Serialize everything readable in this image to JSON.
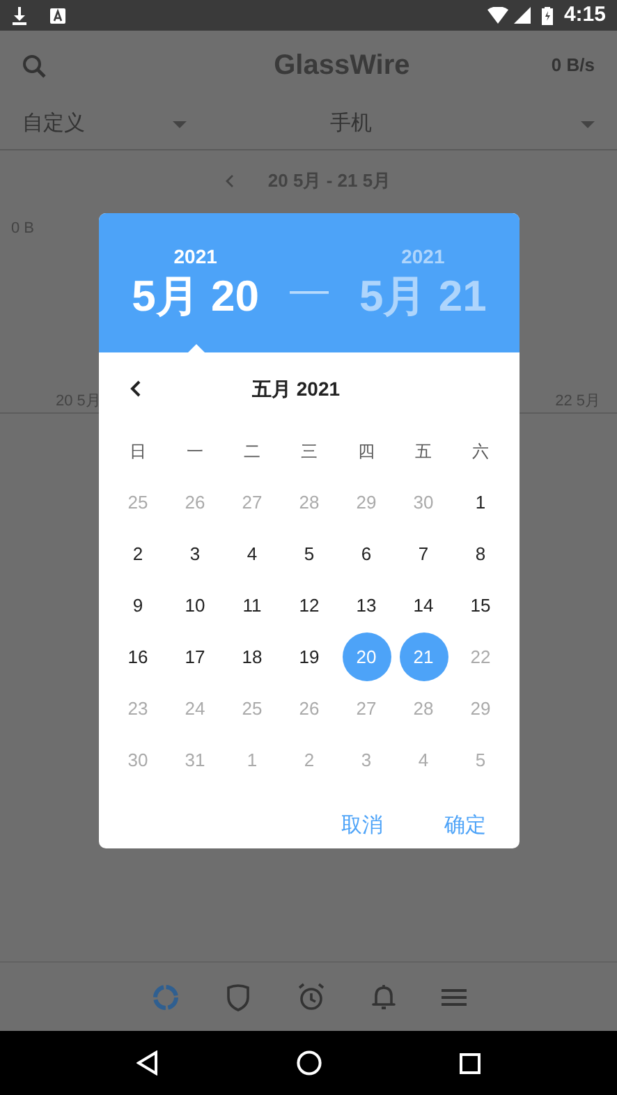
{
  "status_bar": {
    "time": "4:15"
  },
  "app_bar": {
    "title": "GlassWire",
    "speed": "0 B/s"
  },
  "filters": [
    {
      "label": "自定义"
    },
    {
      "label": "手机"
    }
  ],
  "date_nav": {
    "range": "20 5月 - 21 5月"
  },
  "graph": {
    "y_label": "0 B",
    "x_labels": [
      "20 5月",
      "22 5月"
    ]
  },
  "dialog": {
    "start": {
      "year": "2021",
      "date": "5月 20",
      "selected": true
    },
    "separator": "—",
    "end": {
      "year": "2021",
      "date": "5月 21",
      "selected": false
    },
    "month_title": "五月 2021",
    "weekdays": [
      "日",
      "一",
      "二",
      "三",
      "四",
      "五",
      "六"
    ],
    "weeks": [
      [
        {
          "day": "25",
          "disabled": true,
          "selected": false
        },
        {
          "day": "26",
          "disabled": true,
          "selected": false
        },
        {
          "day": "27",
          "disabled": true,
          "selected": false
        },
        {
          "day": "28",
          "disabled": true,
          "selected": false
        },
        {
          "day": "29",
          "disabled": true,
          "selected": false
        },
        {
          "day": "30",
          "disabled": true,
          "selected": false
        },
        {
          "day": "1",
          "disabled": false,
          "selected": false
        }
      ],
      [
        {
          "day": "2",
          "disabled": false,
          "selected": false
        },
        {
          "day": "3",
          "disabled": false,
          "selected": false
        },
        {
          "day": "4",
          "disabled": false,
          "selected": false
        },
        {
          "day": "5",
          "disabled": false,
          "selected": false
        },
        {
          "day": "6",
          "disabled": false,
          "selected": false
        },
        {
          "day": "7",
          "disabled": false,
          "selected": false
        },
        {
          "day": "8",
          "disabled": false,
          "selected": false
        }
      ],
      [
        {
          "day": "9",
          "disabled": false,
          "selected": false
        },
        {
          "day": "10",
          "disabled": false,
          "selected": false
        },
        {
          "day": "11",
          "disabled": false,
          "selected": false
        },
        {
          "day": "12",
          "disabled": false,
          "selected": false
        },
        {
          "day": "13",
          "disabled": false,
          "selected": false
        },
        {
          "day": "14",
          "disabled": false,
          "selected": false
        },
        {
          "day": "15",
          "disabled": false,
          "selected": false
        }
      ],
      [
        {
          "day": "16",
          "disabled": false,
          "selected": false
        },
        {
          "day": "17",
          "disabled": false,
          "selected": false
        },
        {
          "day": "18",
          "disabled": false,
          "selected": false
        },
        {
          "day": "19",
          "disabled": false,
          "selected": false
        },
        {
          "day": "20",
          "disabled": false,
          "selected": true
        },
        {
          "day": "21",
          "disabled": false,
          "selected": true
        },
        {
          "day": "22",
          "disabled": true,
          "selected": false
        }
      ],
      [
        {
          "day": "23",
          "disabled": true,
          "selected": false
        },
        {
          "day": "24",
          "disabled": true,
          "selected": false
        },
        {
          "day": "25",
          "disabled": true,
          "selected": false
        },
        {
          "day": "26",
          "disabled": true,
          "selected": false
        },
        {
          "day": "27",
          "disabled": true,
          "selected": false
        },
        {
          "day": "28",
          "disabled": true,
          "selected": false
        },
        {
          "day": "29",
          "disabled": true,
          "selected": false
        }
      ],
      [
        {
          "day": "30",
          "disabled": true,
          "selected": false
        },
        {
          "day": "31",
          "disabled": true,
          "selected": false
        },
        {
          "day": "1",
          "disabled": true,
          "selected": false
        },
        {
          "day": "2",
          "disabled": true,
          "selected": false
        },
        {
          "day": "3",
          "disabled": true,
          "selected": false
        },
        {
          "day": "4",
          "disabled": true,
          "selected": false
        },
        {
          "day": "5",
          "disabled": true,
          "selected": false
        }
      ]
    ],
    "buttons": [
      "取消",
      "确定"
    ]
  },
  "bottom_nav": [
    {
      "kind": "usage",
      "selected": true
    },
    {
      "kind": "firewall",
      "selected": false
    },
    {
      "kind": "alarm",
      "selected": false
    },
    {
      "kind": "alerts",
      "selected": false
    },
    {
      "kind": "menu",
      "selected": false
    }
  ]
}
